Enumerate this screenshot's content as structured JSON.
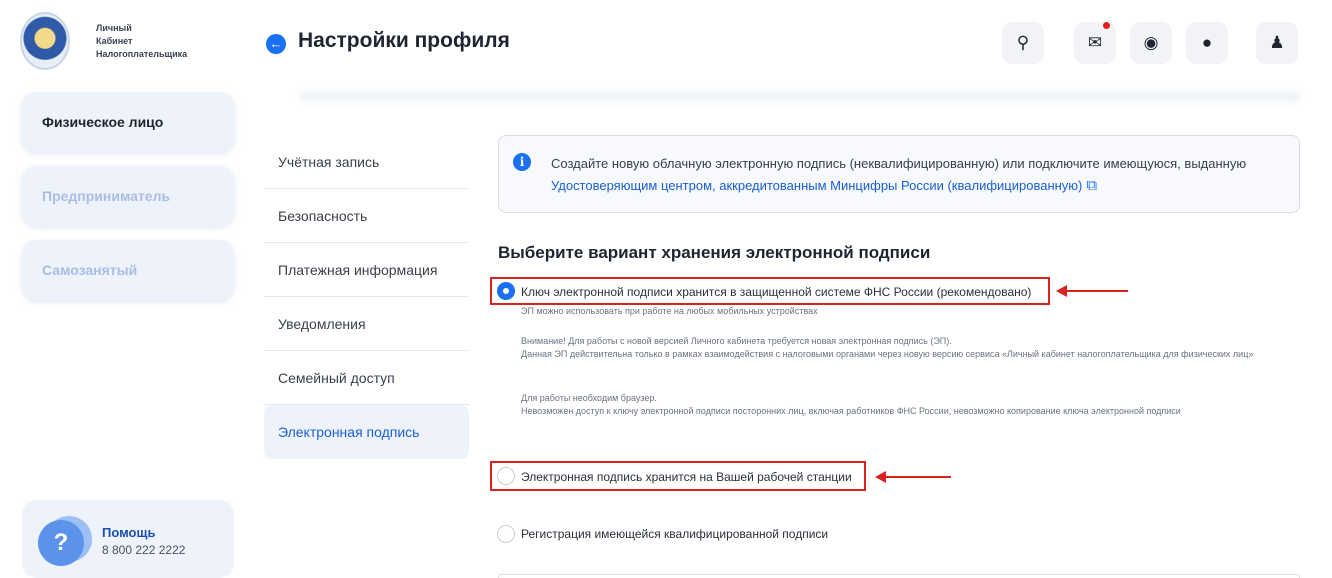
{
  "header": {
    "logo_text": [
      "Личный",
      "Кабинет",
      "Налогоплательщика"
    ],
    "back_icon": "arrow-left-icon",
    "title": "Настройки профиля",
    "icons": [
      "search-icon",
      "mail-icon",
      "eye-off-icon",
      "lightbulb-icon",
      "user-icon"
    ]
  },
  "sidebar": {
    "items": [
      {
        "label": "Физическое лицо",
        "active": true
      },
      {
        "label": "Предприниматель",
        "active": false
      },
      {
        "label": "Самозанятый",
        "active": false
      }
    ],
    "help": {
      "avatar": "?",
      "title": "Помощь",
      "phone": "8 800 222 2222"
    }
  },
  "settings_nav": {
    "items": [
      "Учётная запись",
      "Безопасность",
      "Платежная информация",
      "Уведомления",
      "Семейный доступ",
      "Электронная подпись"
    ],
    "active": "Электронная подпись"
  },
  "info": {
    "icon": "info-icon",
    "text_before": "Создайте новую облачную электронную подпись (неквалифицированную) или подключите имеющуюся, выданную ",
    "link": "Удостоверяющим центром, аккредитованным Минцифры России (квалифицированную)",
    "link_icon": "external-link-icon"
  },
  "storage": {
    "title": "Выберите вариант хранения электронной подписи",
    "options": [
      {
        "label": "Ключ электронной подписи хранится в защищенной системе ФНС России (рекомендовано)",
        "checked": true,
        "notes": [
          "ЭП можно использовать при работе на любых мобильных устройствах",
          "Внимание! Для работы с новой версией Личного кабинета требуется новая электронная подпись (ЭП).",
          "Данная ЭП действительна только в рамках взаимодействия с налоговыми органами через новую версию сервиса «Личный кабинет налогоплательщика для физических лиц»",
          "Для работы необходим браузер.",
          "Невозможен доступ к ключу электронной подписи посторонних лиц, включая работников ФНС России, невозможно копирование ключа электронной подписи"
        ]
      },
      {
        "label": "Электронная подпись хранится на Вашей рабочей станции",
        "checked": false
      },
      {
        "label": "Регистрация имеющейся квалифицированной подписи",
        "checked": false
      }
    ]
  },
  "colors": {
    "accent": "#1a6ff3",
    "highlight": "#d9231f",
    "sidebar_bg": "#eef3fb"
  }
}
